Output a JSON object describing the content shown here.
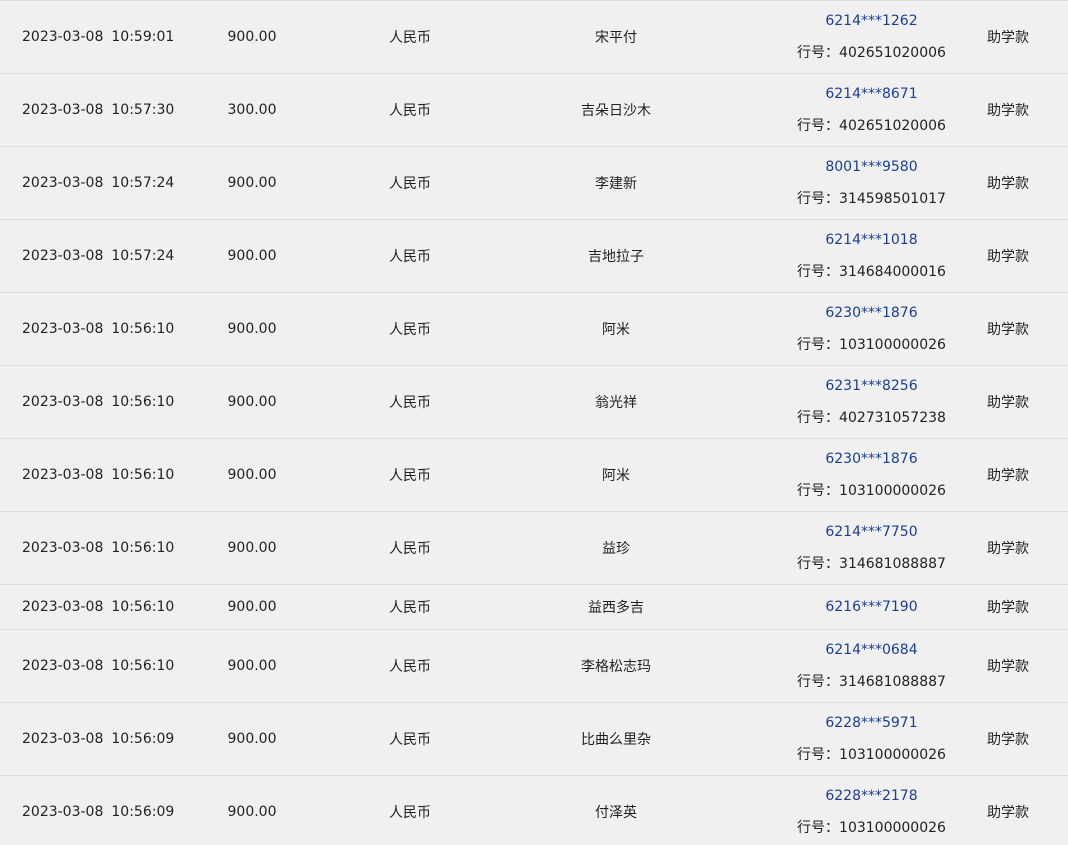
{
  "labels": {
    "bank_prefix": "行号："
  },
  "colors": {
    "background": "#f0f0f0",
    "row_border": "#dcdcdc",
    "account_link": "#1a3e96",
    "text": "#222222"
  },
  "rows": [
    {
      "date": "2023-03-08",
      "time": "10:59:01",
      "amount": "900.00",
      "currency": "人民币",
      "name": "宋平付",
      "account": "6214***1262",
      "bank_no": "402651020006",
      "remark": "助学款"
    },
    {
      "date": "2023-03-08",
      "time": "10:57:30",
      "amount": "300.00",
      "currency": "人民币",
      "name": "吉朵日沙木",
      "account": "6214***8671",
      "bank_no": "402651020006",
      "remark": "助学款"
    },
    {
      "date": "2023-03-08",
      "time": "10:57:24",
      "amount": "900.00",
      "currency": "人民币",
      "name": "李建新",
      "account": "8001***9580",
      "bank_no": "314598501017",
      "remark": "助学款"
    },
    {
      "date": "2023-03-08",
      "time": "10:57:24",
      "amount": "900.00",
      "currency": "人民币",
      "name": "吉地拉子",
      "account": "6214***1018",
      "bank_no": "314684000016",
      "remark": "助学款"
    },
    {
      "date": "2023-03-08",
      "time": "10:56:10",
      "amount": "900.00",
      "currency": "人民币",
      "name": "阿米",
      "account": "6230***1876",
      "bank_no": "103100000026",
      "remark": "助学款"
    },
    {
      "date": "2023-03-08",
      "time": "10:56:10",
      "amount": "900.00",
      "currency": "人民币",
      "name": "翁光祥",
      "account": "6231***8256",
      "bank_no": "402731057238",
      "remark": "助学款"
    },
    {
      "date": "2023-03-08",
      "time": "10:56:10",
      "amount": "900.00",
      "currency": "人民币",
      "name": "阿米",
      "account": "6230***1876",
      "bank_no": "103100000026",
      "remark": "助学款"
    },
    {
      "date": "2023-03-08",
      "time": "10:56:10",
      "amount": "900.00",
      "currency": "人民币",
      "name": "益珍",
      "account": "6214***7750",
      "bank_no": "314681088887",
      "remark": "助学款"
    },
    {
      "date": "2023-03-08",
      "time": "10:56:10",
      "amount": "900.00",
      "currency": "人民币",
      "name": "益西多吉",
      "account": "6216***7190",
      "bank_no": "",
      "remark": "助学款"
    },
    {
      "date": "2023-03-08",
      "time": "10:56:10",
      "amount": "900.00",
      "currency": "人民币",
      "name": "李格松志玛",
      "account": "6214***0684",
      "bank_no": "314681088887",
      "remark": "助学款"
    },
    {
      "date": "2023-03-08",
      "time": "10:56:09",
      "amount": "900.00",
      "currency": "人民币",
      "name": "比曲么里杂",
      "account": "6228***5971",
      "bank_no": "103100000026",
      "remark": "助学款"
    },
    {
      "date": "2023-03-08",
      "time": "10:56:09",
      "amount": "900.00",
      "currency": "人民币",
      "name": "付泽英",
      "account": "6228***2178",
      "bank_no": "103100000026",
      "remark": "助学款"
    }
  ]
}
